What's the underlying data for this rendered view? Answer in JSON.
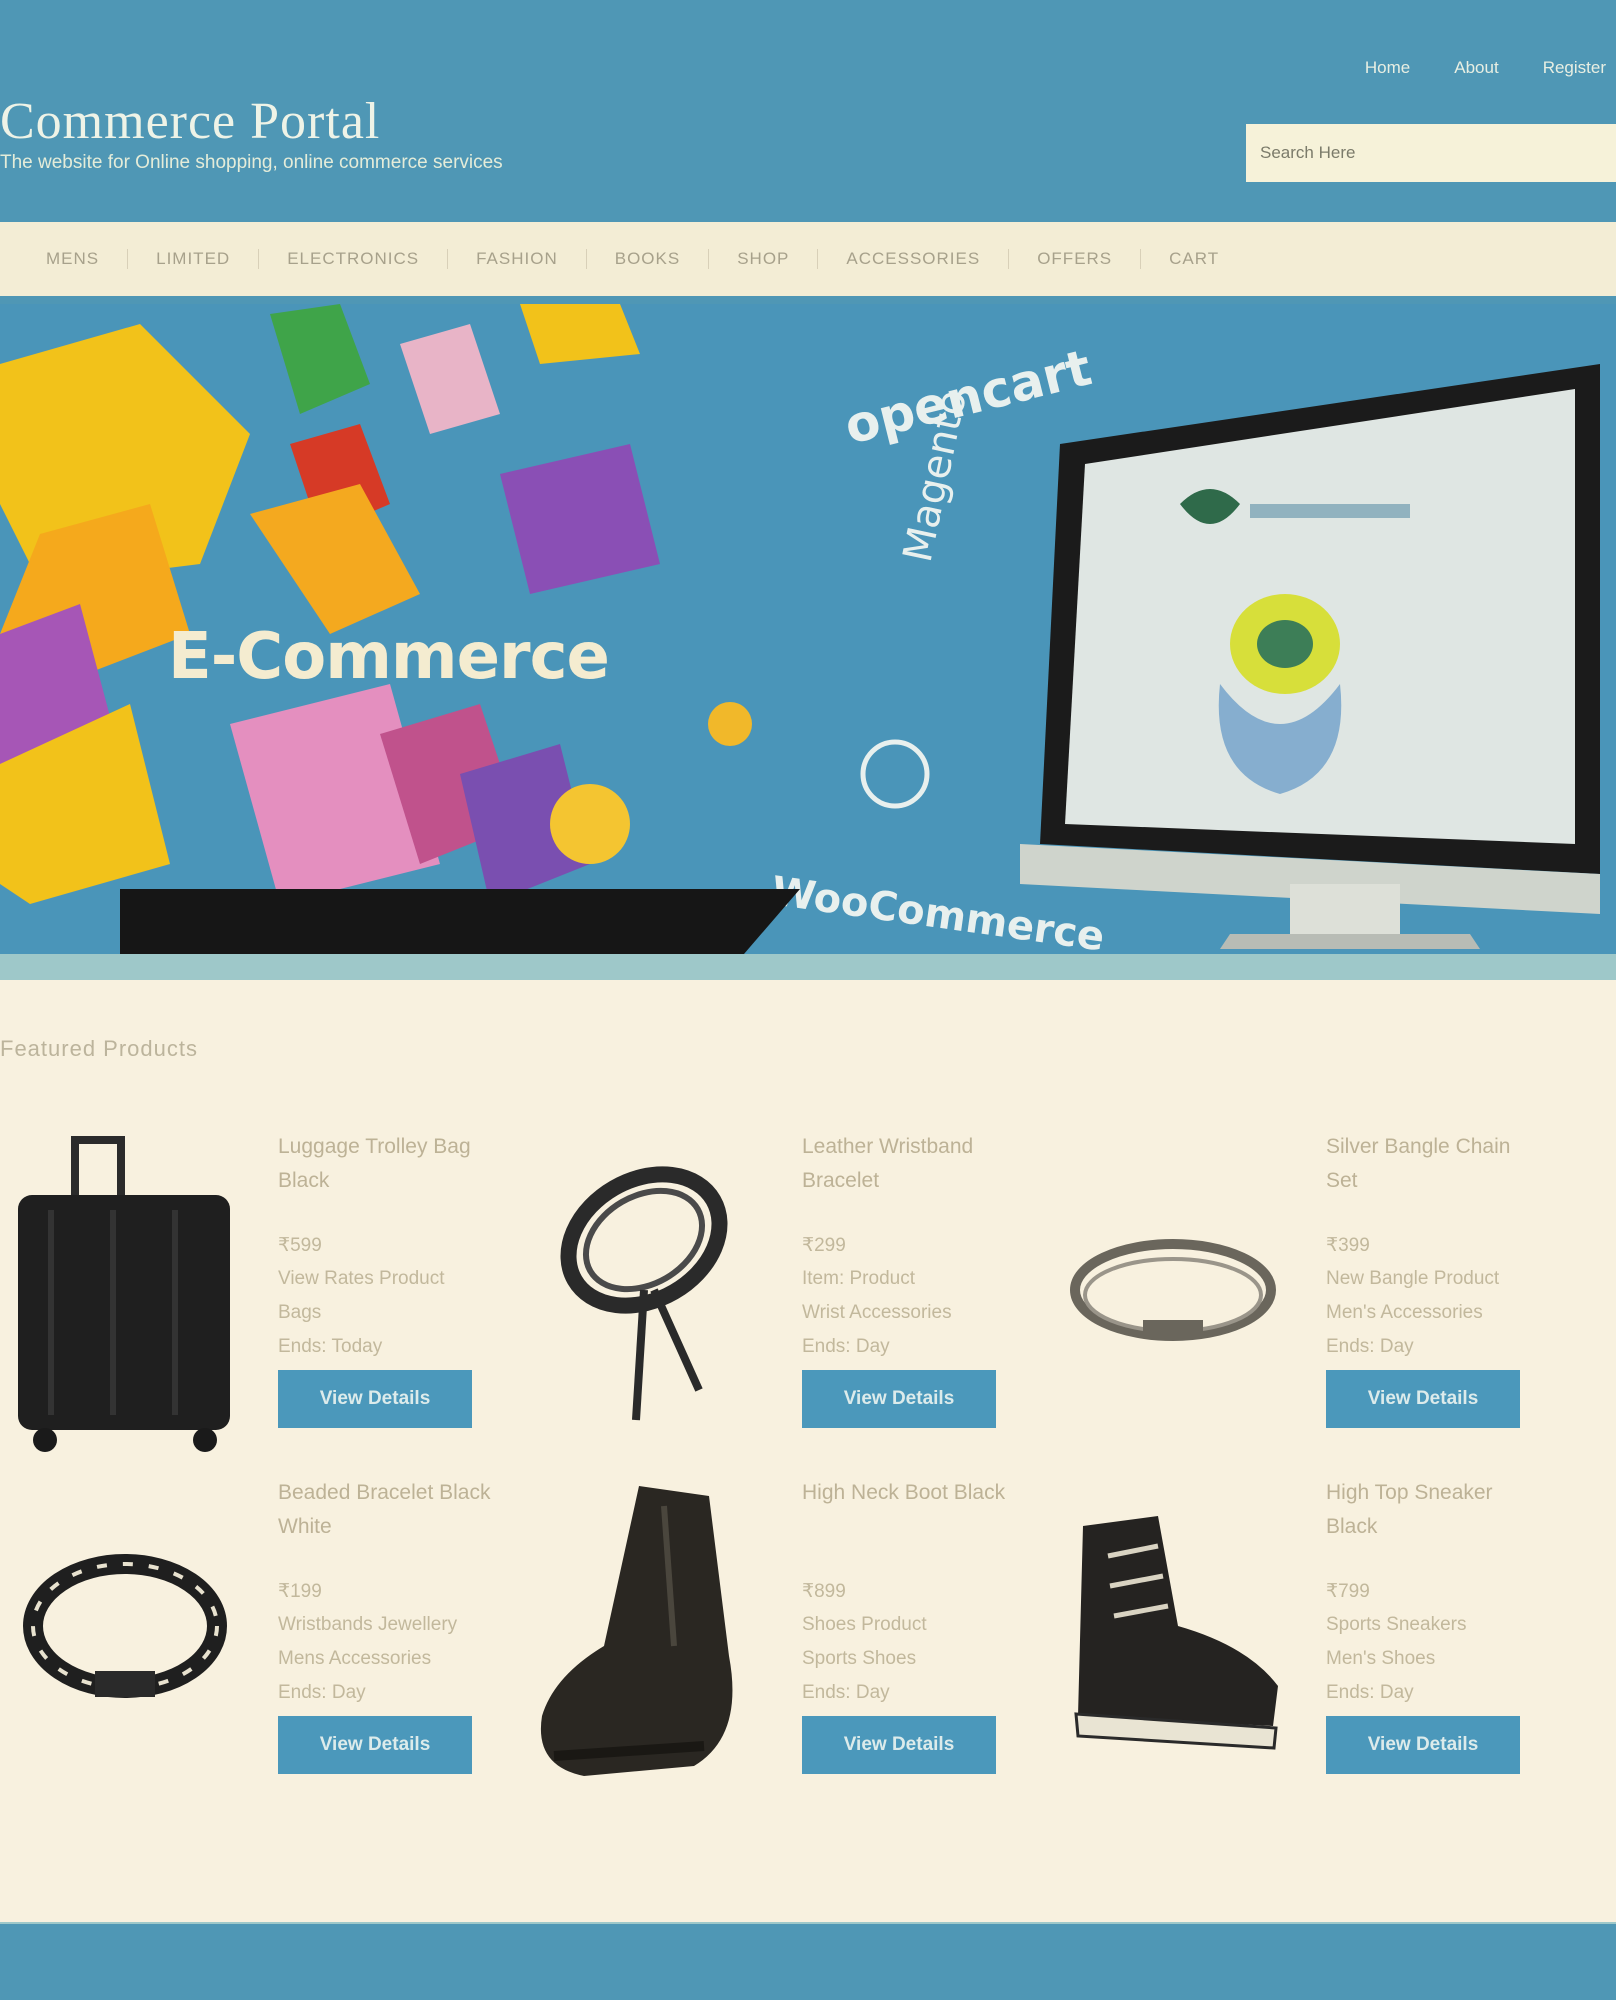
{
  "header": {
    "site_title": "Commerce Portal",
    "tagline": "The website for Online shopping, online commerce services",
    "top_links": [
      "Home",
      "About",
      "Register"
    ],
    "search_placeholder": "Search Here"
  },
  "nav": {
    "items": [
      "MENS",
      "LIMITED",
      "ELECTRONICS",
      "FASHION",
      "BOOKS",
      "SHOP",
      "ACCESSORIES",
      "OFFERS",
      "CART"
    ]
  },
  "banner": {
    "label": "E-Commerce",
    "art_text": [
      "opencart",
      "Magento",
      "WooCommerce"
    ]
  },
  "products": {
    "section_title": "Featured Products",
    "button_label": "View Details",
    "items": [
      {
        "name": "Luggage Trolley Bag Black",
        "line1": "₹599",
        "line2": "View Rates Product",
        "line3": "Bags",
        "line4": "Ends: Today",
        "icon": "luggage-icon"
      },
      {
        "name": "Leather Wristband Bracelet",
        "line1": "₹299",
        "line2": "Item: Product",
        "line3": "Wrist Accessories",
        "line4": "Ends: Day",
        "icon": "leather-bracelet-icon"
      },
      {
        "name": "Silver Bangle Chain Set",
        "line1": "₹399",
        "line2": "New Bangle Product",
        "line3": "Men's Accessories",
        "line4": "Ends: Day",
        "icon": "bangle-icon"
      },
      {
        "name": "Beaded Bracelet Black White",
        "line1": "₹199",
        "line2": "Wristbands Jewellery",
        "line3": "Mens Accessories",
        "line4": "Ends: Day",
        "icon": "beaded-bracelet-icon"
      },
      {
        "name": "High Neck Boot Black",
        "line1": "₹899",
        "line2": "Shoes Product",
        "line3": "Sports Shoes",
        "line4": "Ends: Day",
        "icon": "boot-icon"
      },
      {
        "name": "High Top Sneaker Black",
        "line1": "₹799",
        "line2": "Sports Sneakers",
        "line3": "Men's Shoes",
        "line4": "Ends: Day",
        "icon": "sneaker-icon"
      }
    ]
  }
}
